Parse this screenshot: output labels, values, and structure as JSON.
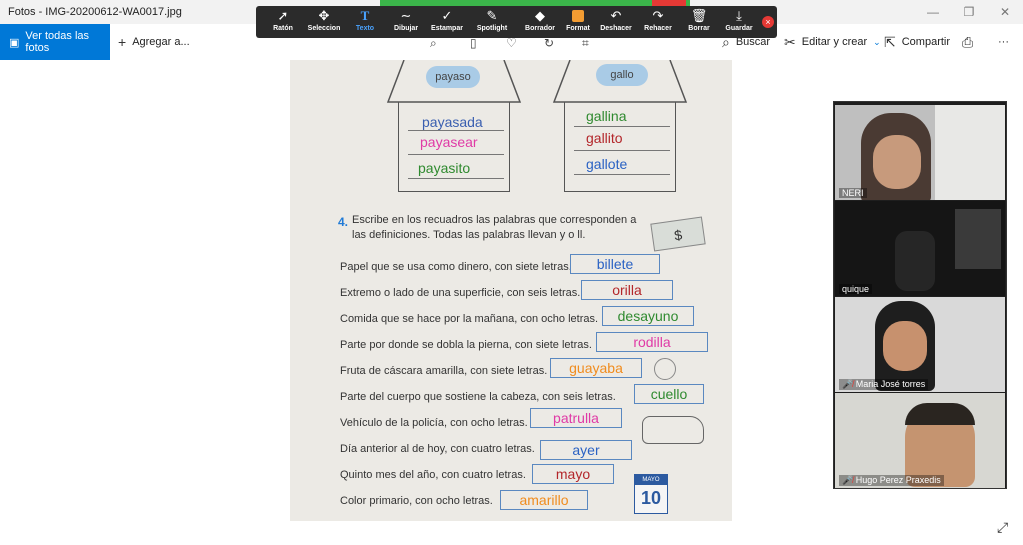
{
  "window": {
    "title": "Fotos - IMG-20200612-WA0017.jpg",
    "controls": [
      "—",
      "❐",
      "✕"
    ]
  },
  "commandbar": {
    "view_all": "Ver todas las fotos",
    "add": "Agregar a...",
    "search": "Buscar",
    "edit": "Editar y crear",
    "share": "Compartir",
    "print_icon": "printer-icon",
    "more": "···"
  },
  "annotation_toolbar": {
    "tools": [
      {
        "label": "Ratón",
        "glyph": "➚"
      },
      {
        "label": "Seleccion",
        "glyph": "✥"
      },
      {
        "label": "Texto",
        "glyph": "T"
      },
      {
        "label": "Dibujar",
        "glyph": "∼"
      },
      {
        "label": "Estampar",
        "glyph": "✓"
      },
      {
        "label": "Spotlight",
        "glyph": "✎"
      },
      {
        "label": "Borrador",
        "glyph": "◆"
      },
      {
        "label": "Format",
        "glyph": ""
      },
      {
        "label": "Deshacer",
        "glyph": "↶"
      },
      {
        "label": "Rehacer",
        "glyph": "↷"
      },
      {
        "label": "Borrar",
        "glyph": "🗑"
      },
      {
        "label": "Guardar",
        "glyph": "⤓"
      }
    ],
    "active": "Texto",
    "close": "×"
  },
  "document": {
    "house_left": {
      "cloud": "payaso",
      "words": [
        "payasada",
        "payasear",
        "payasito"
      ],
      "colors": [
        "#3a5fb0",
        "#e03aa6",
        "#2f8a2f"
      ]
    },
    "house_right": {
      "cloud": "gallo",
      "words": [
        "gallina",
        "gallito",
        "gallote"
      ],
      "colors": [
        "#2f8a2f",
        "#b3262a",
        "#2a62c4"
      ]
    },
    "exercise_number": "4.",
    "exercise_text": "Escribe en los recuadros las palabras que corresponden a las definiciones. Todas las palabras llevan y o ll.",
    "dollar": "$",
    "rows": [
      {
        "clue": "Papel que se usa como dinero, con siete letras.",
        "answer": "billete",
        "color": "#2a62c4"
      },
      {
        "clue": "Extremo o lado de una superficie, con seis letras.",
        "answer": "orilla",
        "color": "#b3262a"
      },
      {
        "clue": "Comida que se hace por la mañana, con ocho letras.",
        "answer": "desayuno",
        "color": "#2f8a2f"
      },
      {
        "clue": "Parte por donde se dobla la pierna, con siete letras.",
        "answer": "rodilla",
        "color": "#e03aa6"
      },
      {
        "clue": "Fruta de cáscara amarilla, con siete letras.",
        "answer": "guayaba",
        "color": "#f08c1e"
      },
      {
        "clue": "Parte del cuerpo que sostiene la cabeza, con seis letras.",
        "answer": "cuello",
        "color": "#2f8a2f"
      },
      {
        "clue": "Vehículo de la policía, con ocho letras.",
        "answer": "patrulla",
        "color": "#e03aa6"
      },
      {
        "clue": "Día anterior al de hoy, con cuatro letras.",
        "answer": "ayer",
        "color": "#2a62c4"
      },
      {
        "clue": "Quinto mes del año, con cuatro letras.",
        "answer": "mayo",
        "color": "#b3262a"
      },
      {
        "clue": "Color primario, con ocho letras.",
        "answer": "amarillo",
        "color": "#f08c1e"
      }
    ],
    "calendar": {
      "month": "MAYO",
      "day": "10"
    }
  },
  "participants": [
    {
      "name": "NERI",
      "muted": false
    },
    {
      "name": "quique",
      "muted": false
    },
    {
      "name": "Maria José torres",
      "muted": true
    },
    {
      "name": "Hugo Perez Praxedis",
      "muted": true
    }
  ]
}
